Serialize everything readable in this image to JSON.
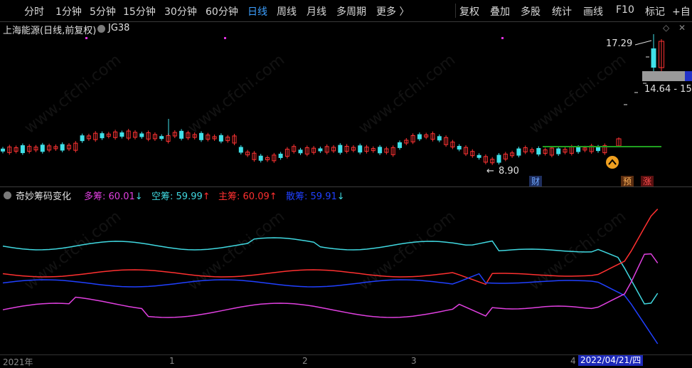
{
  "toolbar": {
    "periods": [
      "分时",
      "1分钟",
      "5分钟",
      "15分钟",
      "30分钟",
      "60分钟",
      "日线",
      "周线",
      "月线",
      "多周期",
      "更多 〉"
    ],
    "active_period": "日线",
    "actions": [
      "复权",
      "叠加",
      "多股",
      "统计",
      "画线",
      "F10",
      "标记",
      "+自"
    ]
  },
  "main_chart": {
    "title": "上海能源(日线,前复权)",
    "indicator": "JG38",
    "high_label": "17.29",
    "low_label": "8.90",
    "price_box": "14.64 - 15",
    "badges": {
      "cai": "财",
      "yu": "预",
      "zhang": "涨"
    }
  },
  "sub_chart": {
    "name": "奇妙筹码变化",
    "items": [
      {
        "label": "多筹:",
        "value": "60.01",
        "arrow": "↓",
        "color": "#e040e0"
      },
      {
        "label": "空筹:",
        "value": "59.99",
        "arrow": "↑",
        "color": "#40d8e0"
      },
      {
        "label": "主筹:",
        "value": "60.09",
        "arrow": "↑",
        "color": "#ff3030"
      },
      {
        "label": "散筹:",
        "value": "59.91",
        "arrow": "↓",
        "color": "#2040ff"
      }
    ]
  },
  "timeline": {
    "labels": [
      "2021年",
      "1",
      "2",
      "3",
      "4"
    ],
    "cursor_date": "2022/04/21/四"
  },
  "watermark": "www.cfchi.com",
  "colors": {
    "up": "#ff3333",
    "down": "#40e0e8",
    "ma": "#1fa01f",
    "accent": "#3da0ff"
  }
}
